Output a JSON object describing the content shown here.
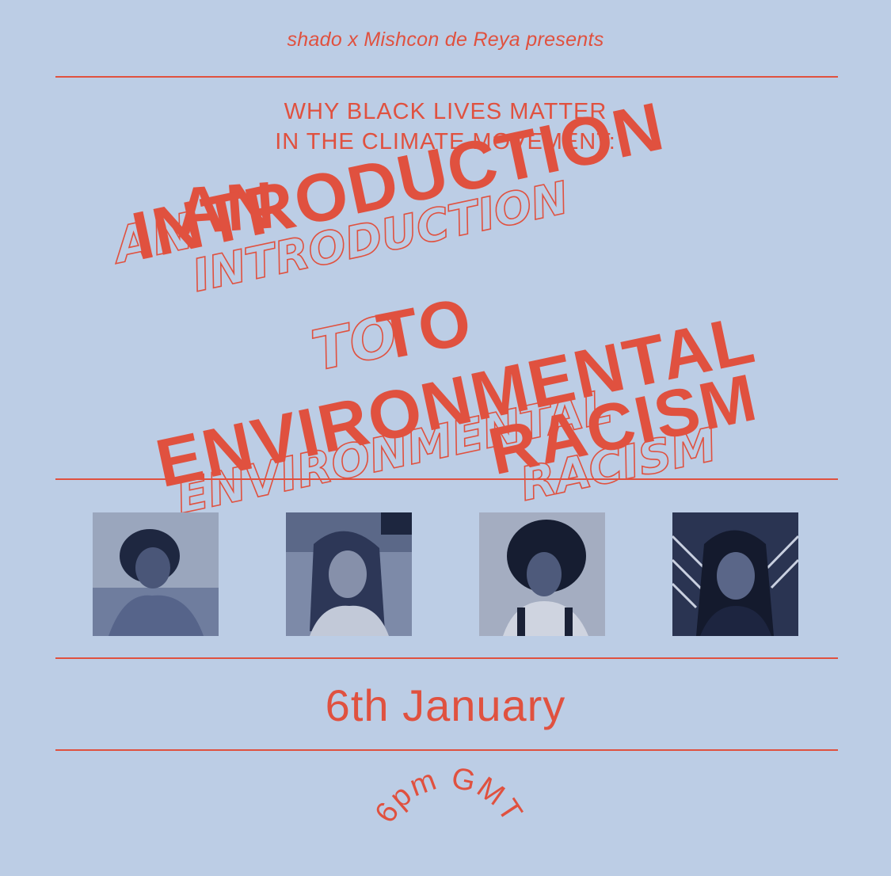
{
  "header": {
    "presenter": "shado x Mishcon de Reya presents"
  },
  "subtitle": {
    "line1": "WHY BLACK LIVES MATTER",
    "line2": "IN THE CLIMATE MOVEMENT:"
  },
  "headline": {
    "line1": "AN",
    "line2": "INTRODUCTION",
    "line3": "TO",
    "line4": "ENVIRONMENTAL",
    "line5": "RACISM"
  },
  "date": "6th January",
  "time": "6pm GMT",
  "colors": {
    "accent": "#e0513f",
    "background": "#bccde5",
    "photo_tint": "#3d4f78"
  }
}
